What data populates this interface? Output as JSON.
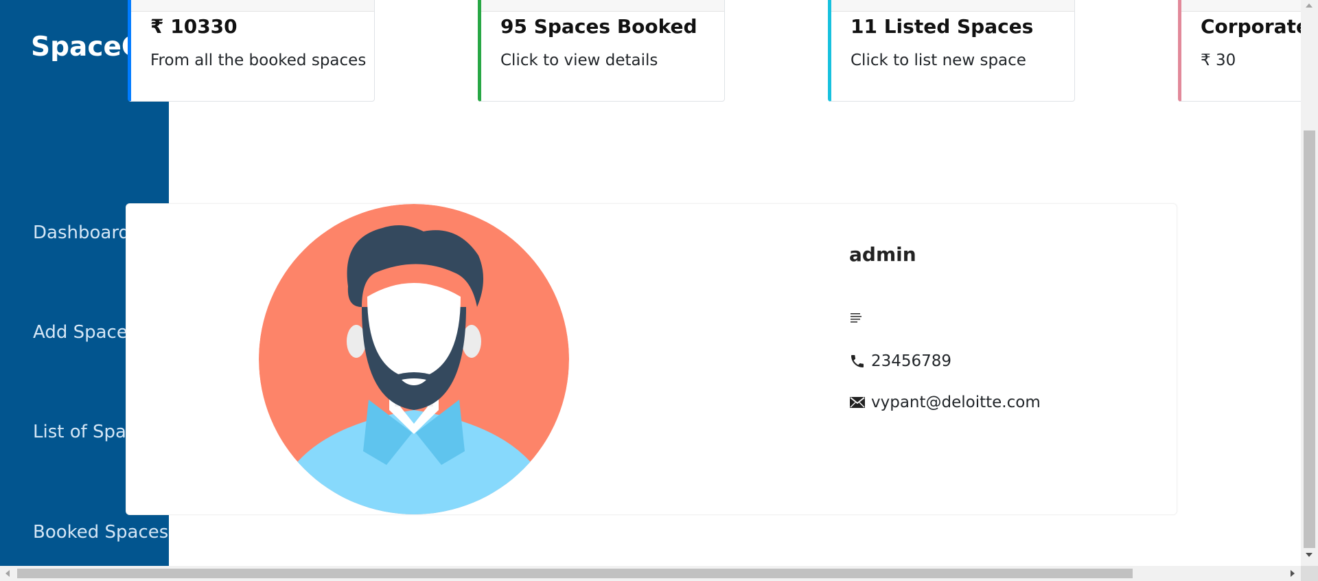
{
  "sidebar": {
    "brand": "SpaceCo",
    "items": [
      {
        "label": "Dashboard"
      },
      {
        "label": "Add Space"
      },
      {
        "label": "List of Spaces"
      },
      {
        "label": "Booked Spaces"
      }
    ],
    "background_color": "#02558f"
  },
  "cards": [
    {
      "title": "₹ 10330",
      "text": "From all the booked spaces",
      "accent": "#007bff"
    },
    {
      "title": "95 Spaces Booked",
      "text": "Click to view details",
      "accent": "#28a745"
    },
    {
      "title": "11 Listed Spaces",
      "text": "Click to list new space",
      "accent": "#17c1de"
    },
    {
      "title": "Corporate :",
      "text": "₹ 30",
      "accent": "#e2899a"
    }
  ],
  "profile": {
    "name": "admin",
    "bio_icon": "align-left-icon",
    "phone": "23456789",
    "phone_icon": "phone-icon",
    "email": "vypant@deloitte.com",
    "email_icon": "envelope-icon",
    "avatar_bg": "#fd8469",
    "avatar_shirt": "#87d9fc"
  }
}
